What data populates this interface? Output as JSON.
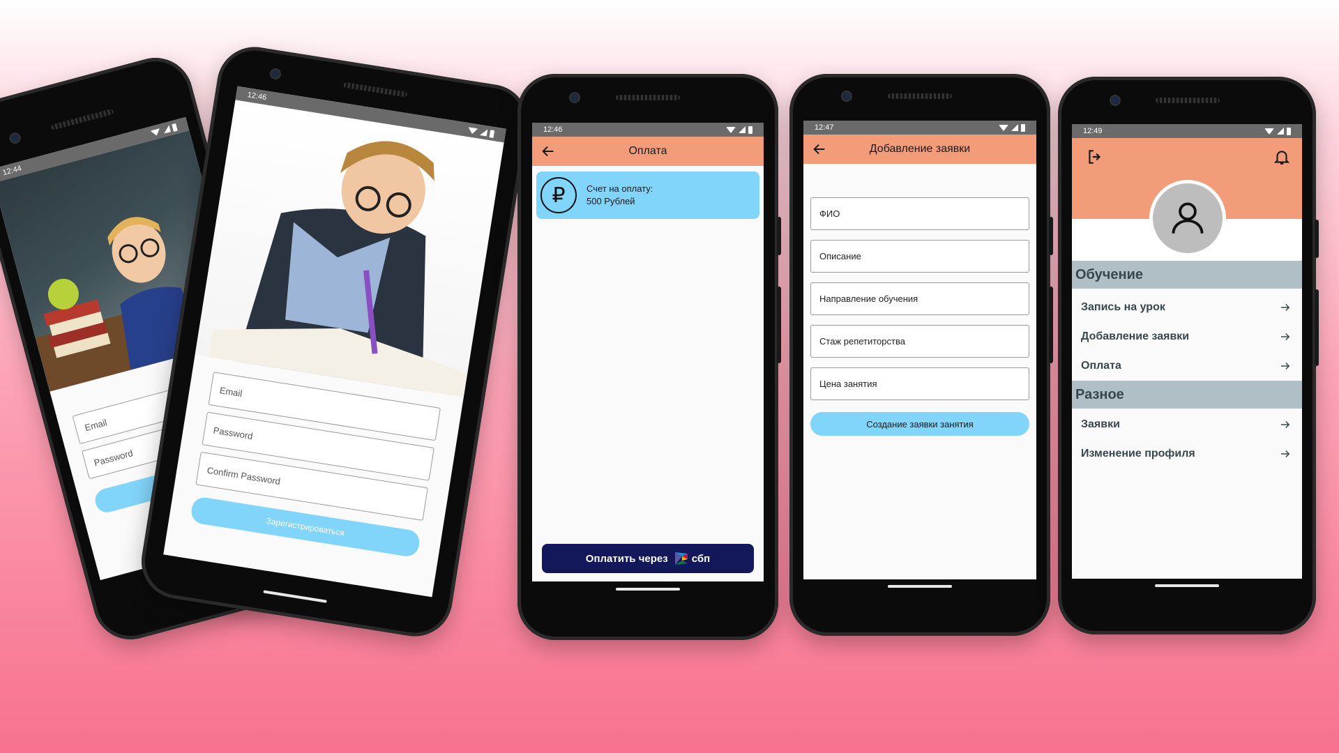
{
  "phone1": {
    "time": "12:44",
    "email_placeholder": "Email",
    "password_placeholder": "Password"
  },
  "phone2": {
    "time": "12:46",
    "email_placeholder": "Email",
    "password_placeholder": "Password",
    "confirm_placeholder": "Confirm Password",
    "register_label": "Зарегистрироваться"
  },
  "payment": {
    "time": "12:46",
    "title": "Оплата",
    "invoice_label": "Счет на оплату:",
    "invoice_amount": "500 Рублей",
    "currency_symbol": "₽",
    "pay_button_label": "Оплатить через",
    "sbp_label": "сбп"
  },
  "request": {
    "time": "12:47",
    "title": "Добавление заявки",
    "fields": [
      {
        "label": "ФИО"
      },
      {
        "label": "Описание"
      },
      {
        "label": "Направление обучения"
      },
      {
        "label": "Стаж репетиторства"
      },
      {
        "label": "Цена занятия"
      }
    ],
    "submit_label": "Создание заявки занятия"
  },
  "profile": {
    "time": "12:49",
    "sections": [
      {
        "title": "Обучение",
        "items": [
          {
            "label": "Запись на урок"
          },
          {
            "label": "Добавление заявки"
          },
          {
            "label": "Оплата"
          }
        ]
      },
      {
        "title": "Разное",
        "items": [
          {
            "label": "Заявки"
          },
          {
            "label": "Изменение профиля"
          }
        ]
      }
    ]
  },
  "colors": {
    "appbar": "#f29c7a",
    "accent_blue": "#81d4fa",
    "section_bg": "#b0bec5",
    "pay_button": "#12185a"
  }
}
